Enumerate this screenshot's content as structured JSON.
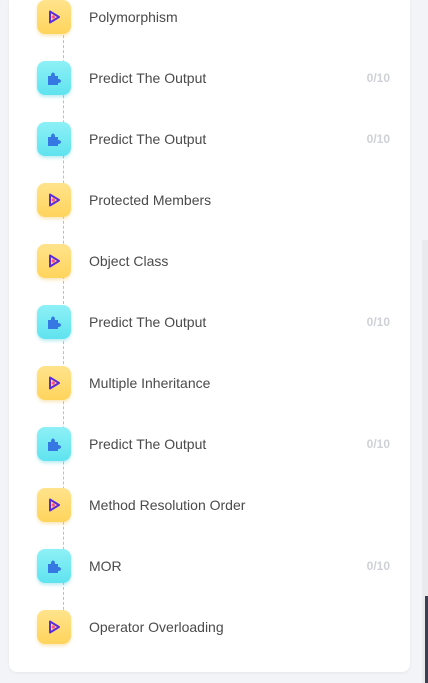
{
  "colors": {
    "video_badge": "#ffd45c",
    "video_icon": "#5b2be0",
    "puzzle_badge": "#5fe3ef",
    "puzzle_icon": "#3577e3",
    "score_text": "#cfd1d6",
    "timeline": "#f0a9a9"
  },
  "lessons": [
    {
      "type": "video",
      "icon": "play-icon",
      "title": "Polymorphism",
      "score": ""
    },
    {
      "type": "puzzle",
      "icon": "puzzle-icon",
      "title": "Predict The Output",
      "score": "0/10"
    },
    {
      "type": "puzzle",
      "icon": "puzzle-icon",
      "title": "Predict The Output",
      "score": "0/10"
    },
    {
      "type": "video",
      "icon": "play-icon",
      "title": "Protected Members",
      "score": ""
    },
    {
      "type": "video",
      "icon": "play-icon",
      "title": "Object Class",
      "score": ""
    },
    {
      "type": "puzzle",
      "icon": "puzzle-icon",
      "title": "Predict The Output",
      "score": "0/10"
    },
    {
      "type": "video",
      "icon": "play-icon",
      "title": "Multiple Inheritance",
      "score": ""
    },
    {
      "type": "puzzle",
      "icon": "puzzle-icon",
      "title": "Predict The Output",
      "score": "0/10"
    },
    {
      "type": "video",
      "icon": "play-icon",
      "title": "Method Resolution Order",
      "score": ""
    },
    {
      "type": "puzzle",
      "icon": "puzzle-icon",
      "title": "MOR",
      "score": "0/10"
    },
    {
      "type": "video",
      "icon": "play-icon",
      "title": "Operator Overloading",
      "score": ""
    }
  ]
}
